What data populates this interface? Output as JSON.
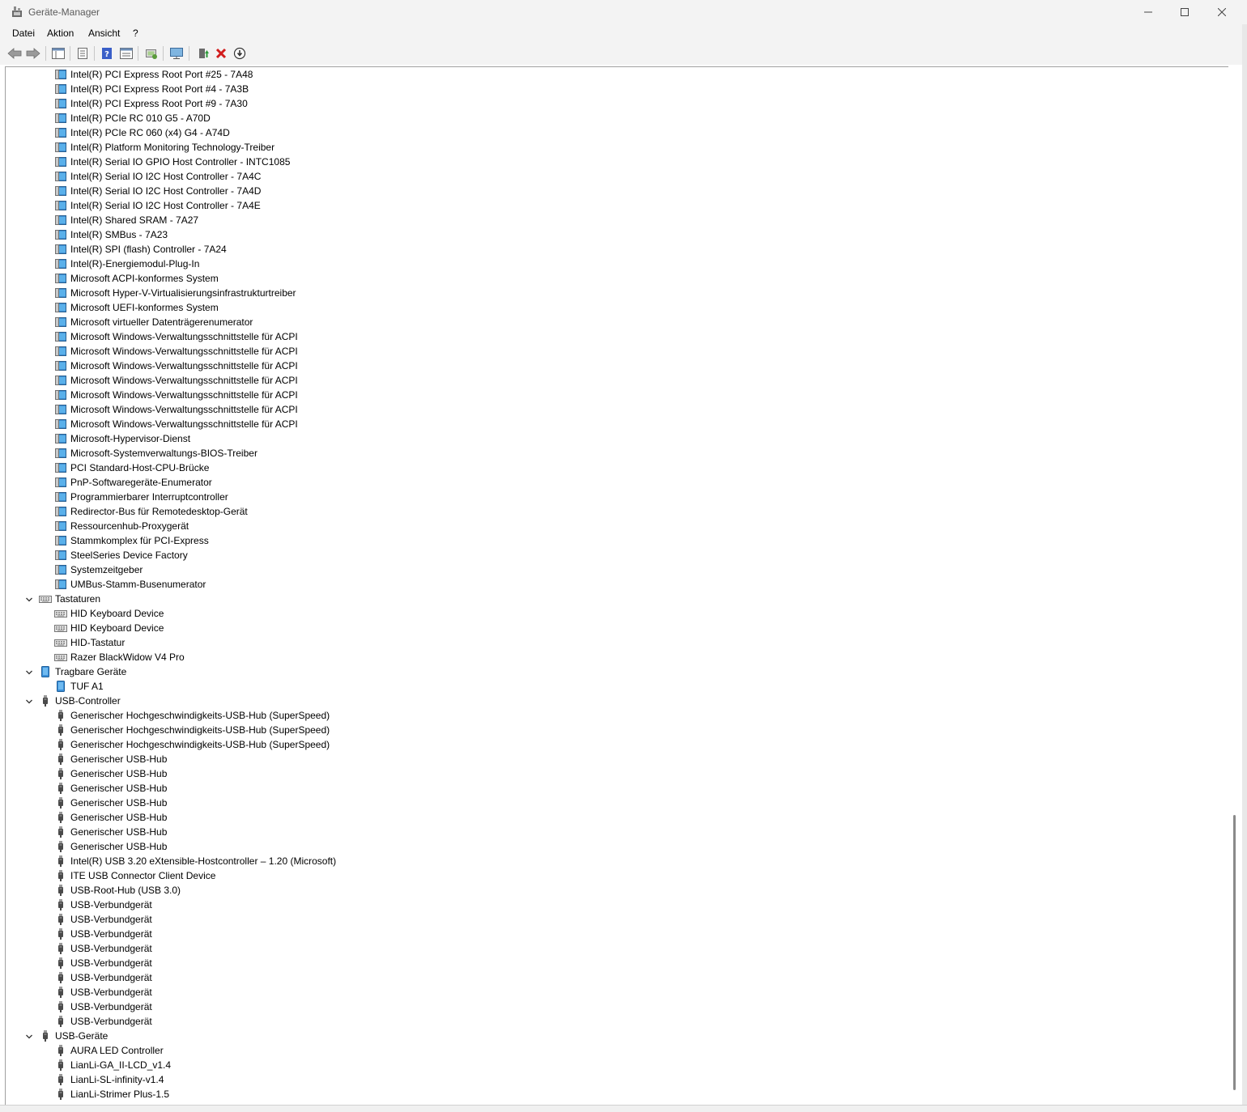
{
  "window": {
    "title": "Geräte-Manager"
  },
  "menu": [
    "Datei",
    "Aktion",
    "Ansicht",
    "?"
  ],
  "toolbar": {
    "buttons": [
      "back-icon",
      "forward-icon",
      "show-hide-console-tree-icon",
      "properties-icon",
      "help-icon",
      "action-pane-icon",
      "scan-hardware-icon",
      "monitor-icon",
      "update-driver-icon",
      "uninstall-icon",
      "disable-device-icon"
    ]
  },
  "tree": [
    {
      "level": 1,
      "icon": "system-device-icon",
      "label": "Intel(R) PCI Express Root Port #25 - 7A48"
    },
    {
      "level": 1,
      "icon": "system-device-icon",
      "label": "Intel(R) PCI Express Root Port #4 - 7A3B"
    },
    {
      "level": 1,
      "icon": "system-device-icon",
      "label": "Intel(R) PCI Express Root Port #9 - 7A30"
    },
    {
      "level": 1,
      "icon": "system-device-icon",
      "label": "Intel(R) PCIe RC 010 G5 - A70D"
    },
    {
      "level": 1,
      "icon": "system-device-icon",
      "label": "Intel(R) PCIe RC 060 (x4) G4 - A74D"
    },
    {
      "level": 1,
      "icon": "system-device-icon",
      "label": "Intel(R) Platform Monitoring Technology-Treiber"
    },
    {
      "level": 1,
      "icon": "system-device-icon",
      "label": "Intel(R) Serial IO GPIO Host Controller - INTC1085"
    },
    {
      "level": 1,
      "icon": "system-device-icon",
      "label": "Intel(R) Serial IO I2C Host Controller - 7A4C"
    },
    {
      "level": 1,
      "icon": "system-device-icon",
      "label": "Intel(R) Serial IO I2C Host Controller - 7A4D"
    },
    {
      "level": 1,
      "icon": "system-device-icon",
      "label": "Intel(R) Serial IO I2C Host Controller - 7A4E"
    },
    {
      "level": 1,
      "icon": "system-device-icon",
      "label": "Intel(R) Shared SRAM - 7A27"
    },
    {
      "level": 1,
      "icon": "system-device-icon",
      "label": "Intel(R) SMBus - 7A23"
    },
    {
      "level": 1,
      "icon": "system-device-icon",
      "label": "Intel(R) SPI (flash) Controller - 7A24"
    },
    {
      "level": 1,
      "icon": "system-device-icon",
      "label": "Intel(R)-Energiemodul-Plug-In"
    },
    {
      "level": 1,
      "icon": "system-device-icon",
      "label": "Microsoft ACPI-konformes System"
    },
    {
      "level": 1,
      "icon": "system-device-icon",
      "label": "Microsoft Hyper-V-Virtualisierungsinfrastrukturtreiber"
    },
    {
      "level": 1,
      "icon": "system-device-icon",
      "label": "Microsoft UEFI-konformes System"
    },
    {
      "level": 1,
      "icon": "system-device-icon",
      "label": "Microsoft virtueller Datenträgerenumerator"
    },
    {
      "level": 1,
      "icon": "system-device-icon",
      "label": "Microsoft Windows-Verwaltungsschnittstelle für ACPI"
    },
    {
      "level": 1,
      "icon": "system-device-icon",
      "label": "Microsoft Windows-Verwaltungsschnittstelle für ACPI"
    },
    {
      "level": 1,
      "icon": "system-device-icon",
      "label": "Microsoft Windows-Verwaltungsschnittstelle für ACPI"
    },
    {
      "level": 1,
      "icon": "system-device-icon",
      "label": "Microsoft Windows-Verwaltungsschnittstelle für ACPI"
    },
    {
      "level": 1,
      "icon": "system-device-icon",
      "label": "Microsoft Windows-Verwaltungsschnittstelle für ACPI"
    },
    {
      "level": 1,
      "icon": "system-device-icon",
      "label": "Microsoft Windows-Verwaltungsschnittstelle für ACPI"
    },
    {
      "level": 1,
      "icon": "system-device-icon",
      "label": "Microsoft Windows-Verwaltungsschnittstelle für ACPI"
    },
    {
      "level": 1,
      "icon": "system-device-icon",
      "label": "Microsoft-Hypervisor-Dienst"
    },
    {
      "level": 1,
      "icon": "system-device-icon",
      "label": "Microsoft-Systemverwaltungs-BIOS-Treiber"
    },
    {
      "level": 1,
      "icon": "system-device-icon",
      "label": "PCI Standard-Host-CPU-Brücke"
    },
    {
      "level": 1,
      "icon": "system-device-icon",
      "label": "PnP-Softwaregeräte-Enumerator"
    },
    {
      "level": 1,
      "icon": "system-device-icon",
      "label": "Programmierbarer Interruptcontroller"
    },
    {
      "level": 1,
      "icon": "system-device-icon",
      "label": "Redirector-Bus für Remotedesktop-Gerät"
    },
    {
      "level": 1,
      "icon": "system-device-icon",
      "label": "Ressourcenhub-Proxygerät"
    },
    {
      "level": 1,
      "icon": "system-device-icon",
      "label": "Stammkomplex für PCI-Express"
    },
    {
      "level": 1,
      "icon": "system-device-icon",
      "label": "SteelSeries Device Factory"
    },
    {
      "level": 1,
      "icon": "system-device-icon",
      "label": "Systemzeitgeber"
    },
    {
      "level": 1,
      "icon": "system-device-icon",
      "label": "UMBus-Stamm-Busenumerator"
    },
    {
      "level": 0,
      "icon": "keyboard-icon",
      "label": "Tastaturen",
      "expanded": true
    },
    {
      "level": 1,
      "icon": "keyboard-icon",
      "label": "HID Keyboard Device"
    },
    {
      "level": 1,
      "icon": "keyboard-icon",
      "label": "HID Keyboard Device"
    },
    {
      "level": 1,
      "icon": "keyboard-icon",
      "label": "HID-Tastatur"
    },
    {
      "level": 1,
      "icon": "keyboard-icon",
      "label": "Razer BlackWidow V4 Pro"
    },
    {
      "level": 0,
      "icon": "portable-device-icon",
      "label": "Tragbare Geräte",
      "expanded": true
    },
    {
      "level": 1,
      "icon": "portable-device-icon",
      "label": "TUF A1"
    },
    {
      "level": 0,
      "icon": "usb-icon",
      "label": "USB-Controller",
      "expanded": true
    },
    {
      "level": 1,
      "icon": "usb-icon",
      "label": "Generischer Hochgeschwindigkeits-USB-Hub (SuperSpeed)"
    },
    {
      "level": 1,
      "icon": "usb-icon",
      "label": "Generischer Hochgeschwindigkeits-USB-Hub (SuperSpeed)"
    },
    {
      "level": 1,
      "icon": "usb-icon",
      "label": "Generischer Hochgeschwindigkeits-USB-Hub (SuperSpeed)"
    },
    {
      "level": 1,
      "icon": "usb-icon",
      "label": "Generischer USB-Hub"
    },
    {
      "level": 1,
      "icon": "usb-icon",
      "label": "Generischer USB-Hub"
    },
    {
      "level": 1,
      "icon": "usb-icon",
      "label": "Generischer USB-Hub"
    },
    {
      "level": 1,
      "icon": "usb-icon",
      "label": "Generischer USB-Hub"
    },
    {
      "level": 1,
      "icon": "usb-icon",
      "label": "Generischer USB-Hub"
    },
    {
      "level": 1,
      "icon": "usb-icon",
      "label": "Generischer USB-Hub"
    },
    {
      "level": 1,
      "icon": "usb-icon",
      "label": "Generischer USB-Hub"
    },
    {
      "level": 1,
      "icon": "usb-icon",
      "label": "Intel(R) USB 3.20 eXtensible-Hostcontroller – 1.20 (Microsoft)"
    },
    {
      "level": 1,
      "icon": "usb-icon",
      "label": "ITE USB Connector Client Device"
    },
    {
      "level": 1,
      "icon": "usb-icon",
      "label": "USB-Root-Hub (USB 3.0)"
    },
    {
      "level": 1,
      "icon": "usb-icon",
      "label": "USB-Verbundgerät"
    },
    {
      "level": 1,
      "icon": "usb-icon",
      "label": "USB-Verbundgerät"
    },
    {
      "level": 1,
      "icon": "usb-icon",
      "label": "USB-Verbundgerät"
    },
    {
      "level": 1,
      "icon": "usb-icon",
      "label": "USB-Verbundgerät"
    },
    {
      "level": 1,
      "icon": "usb-icon",
      "label": "USB-Verbundgerät"
    },
    {
      "level": 1,
      "icon": "usb-icon",
      "label": "USB-Verbundgerät"
    },
    {
      "level": 1,
      "icon": "usb-icon",
      "label": "USB-Verbundgerät"
    },
    {
      "level": 1,
      "icon": "usb-icon",
      "label": "USB-Verbundgerät"
    },
    {
      "level": 1,
      "icon": "usb-icon",
      "label": "USB-Verbundgerät"
    },
    {
      "level": 0,
      "icon": "usb-icon",
      "label": "USB-Geräte",
      "expanded": true
    },
    {
      "level": 1,
      "icon": "usb-icon",
      "label": "AURA LED Controller"
    },
    {
      "level": 1,
      "icon": "usb-icon",
      "label": "LianLi-GA_II-LCD_v1.4"
    },
    {
      "level": 1,
      "icon": "usb-icon",
      "label": "LianLi-SL-infinity-v1.4"
    },
    {
      "level": 1,
      "icon": "usb-icon",
      "label": "LianLi-Strimer Plus-1.5"
    }
  ]
}
